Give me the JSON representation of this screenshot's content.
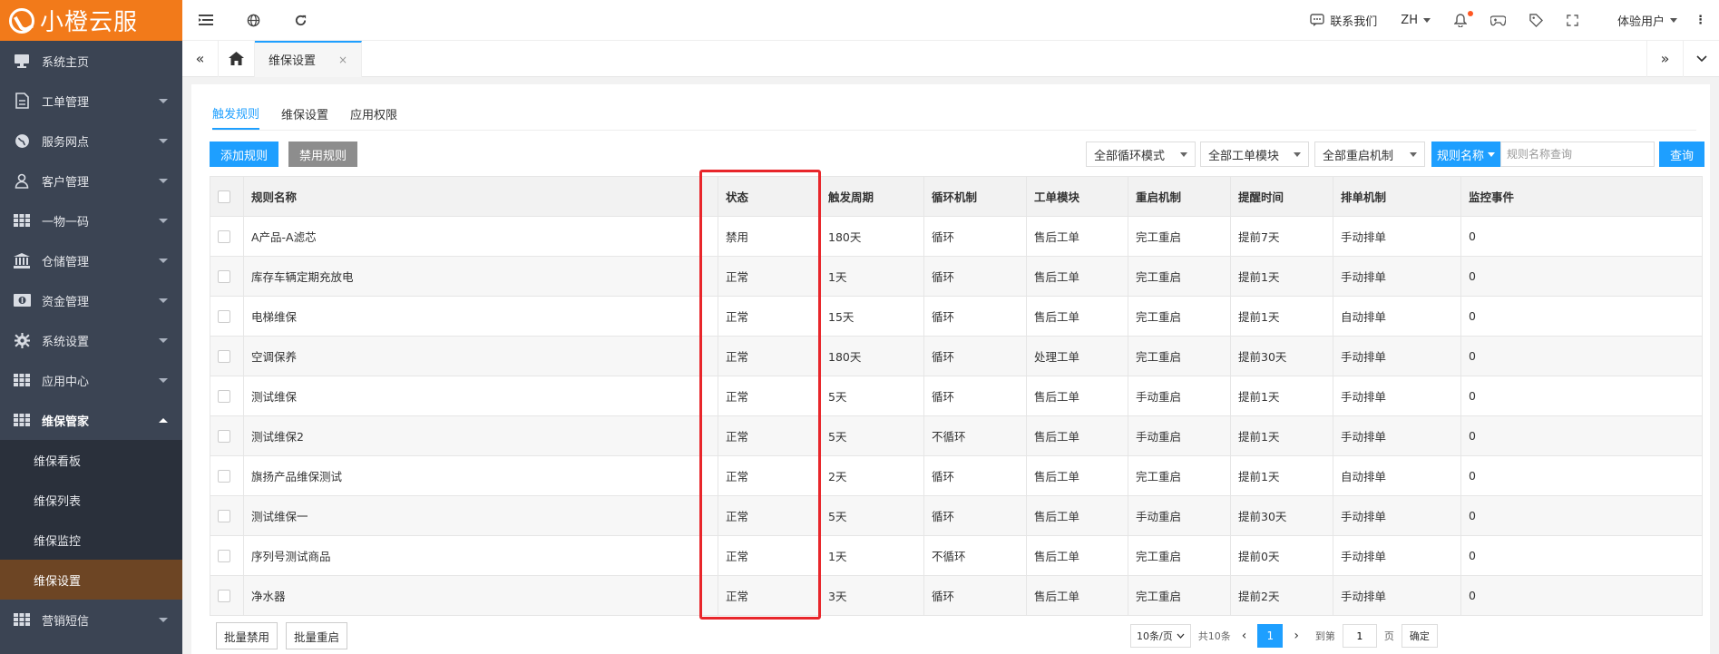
{
  "app": {
    "logo_text": "小橙云服"
  },
  "sidebar": {
    "items": [
      {
        "label": "系统主页",
        "icon": "monitor-icon",
        "has_caret": false
      },
      {
        "label": "工单管理",
        "icon": "document-icon",
        "has_caret": true
      },
      {
        "label": "服务网点",
        "icon": "globe-icon",
        "has_caret": true
      },
      {
        "label": "客户管理",
        "icon": "user-icon",
        "has_caret": true
      },
      {
        "label": "一物一码",
        "icon": "grid-icon",
        "has_caret": true
      },
      {
        "label": "仓储管理",
        "icon": "bank-icon",
        "has_caret": true
      },
      {
        "label": "资金管理",
        "icon": "money-icon",
        "has_caret": true
      },
      {
        "label": "系统设置",
        "icon": "gear-icon",
        "has_caret": true
      },
      {
        "label": "应用中心",
        "icon": "grid-icon",
        "has_caret": true
      }
    ],
    "open_group": {
      "label": "维保管家",
      "icon": "grid-icon"
    },
    "sub_items": [
      "维保看板",
      "维保列表",
      "维保监控",
      "维保设置"
    ],
    "active_sub": "维保设置",
    "after_items": [
      {
        "label": "营销短信",
        "icon": "grid-icon"
      }
    ]
  },
  "topbar": {
    "contact_label": "联系我们",
    "lang_label": "ZH",
    "user_label": "体验用户"
  },
  "tabstrip": {
    "active_tab": "维保设置",
    "close_glyph": "×"
  },
  "subtabs": [
    "触发规则",
    "维保设置",
    "应用权限"
  ],
  "toolbar": {
    "add_label": "添加规则",
    "disable_label": "禁用规则",
    "filter1": "全部循环模式",
    "filter2": "全部工单模块",
    "filter3": "全部重启机制",
    "search_field": "规则名称",
    "search_placeholder": "规则名称查询",
    "query_label": "查询"
  },
  "table": {
    "headers": [
      "规则名称",
      "状态",
      "触发周期",
      "循环机制",
      "工单模块",
      "重启机制",
      "提醒时间",
      "排单机制",
      "监控事件"
    ],
    "rows": [
      [
        "A产品-A滤芯",
        "禁用",
        "180天",
        "循环",
        "售后工单",
        "完工重启",
        "提前7天",
        "手动排单",
        "0"
      ],
      [
        "库存车辆定期充放电",
        "正常",
        "1天",
        "循环",
        "售后工单",
        "完工重启",
        "提前1天",
        "手动排单",
        "0"
      ],
      [
        "电梯维保",
        "正常",
        "15天",
        "循环",
        "售后工单",
        "完工重启",
        "提前1天",
        "自动排单",
        "0"
      ],
      [
        "空调保养",
        "正常",
        "180天",
        "循环",
        "处理工单",
        "完工重启",
        "提前30天",
        "手动排单",
        "0"
      ],
      [
        "测试维保",
        "正常",
        "5天",
        "循环",
        "售后工单",
        "手动重启",
        "提前1天",
        "手动排单",
        "0"
      ],
      [
        "测试维保2",
        "正常",
        "5天",
        "不循环",
        "售后工单",
        "手动重启",
        "提前1天",
        "手动排单",
        "0"
      ],
      [
        "旗扬产品维保测试",
        "正常",
        "2天",
        "循环",
        "售后工单",
        "完工重启",
        "提前1天",
        "自动排单",
        "0"
      ],
      [
        "测试维保一",
        "正常",
        "5天",
        "循环",
        "售后工单",
        "手动重启",
        "提前30天",
        "手动排单",
        "0"
      ],
      [
        "序列号测试商品",
        "正常",
        "1天",
        "不循环",
        "售后工单",
        "完工重启",
        "提前0天",
        "手动排单",
        "0"
      ],
      [
        "净水器",
        "正常",
        "3天",
        "循环",
        "售后工单",
        "完工重启",
        "提前2天",
        "手动排单",
        "0"
      ]
    ]
  },
  "footer": {
    "batch_disable": "批量禁用",
    "batch_restart": "批量重启",
    "page_size": "10条/页",
    "total": "共10条",
    "current_page": "1",
    "goto_label": "到第",
    "goto_value": "1",
    "page_unit": "页",
    "confirm": "确定"
  },
  "colors": {
    "brand": "#f27a1a",
    "accent": "#1e9fff",
    "highlight": "#e8262b",
    "sidebar": "#3b4453"
  }
}
